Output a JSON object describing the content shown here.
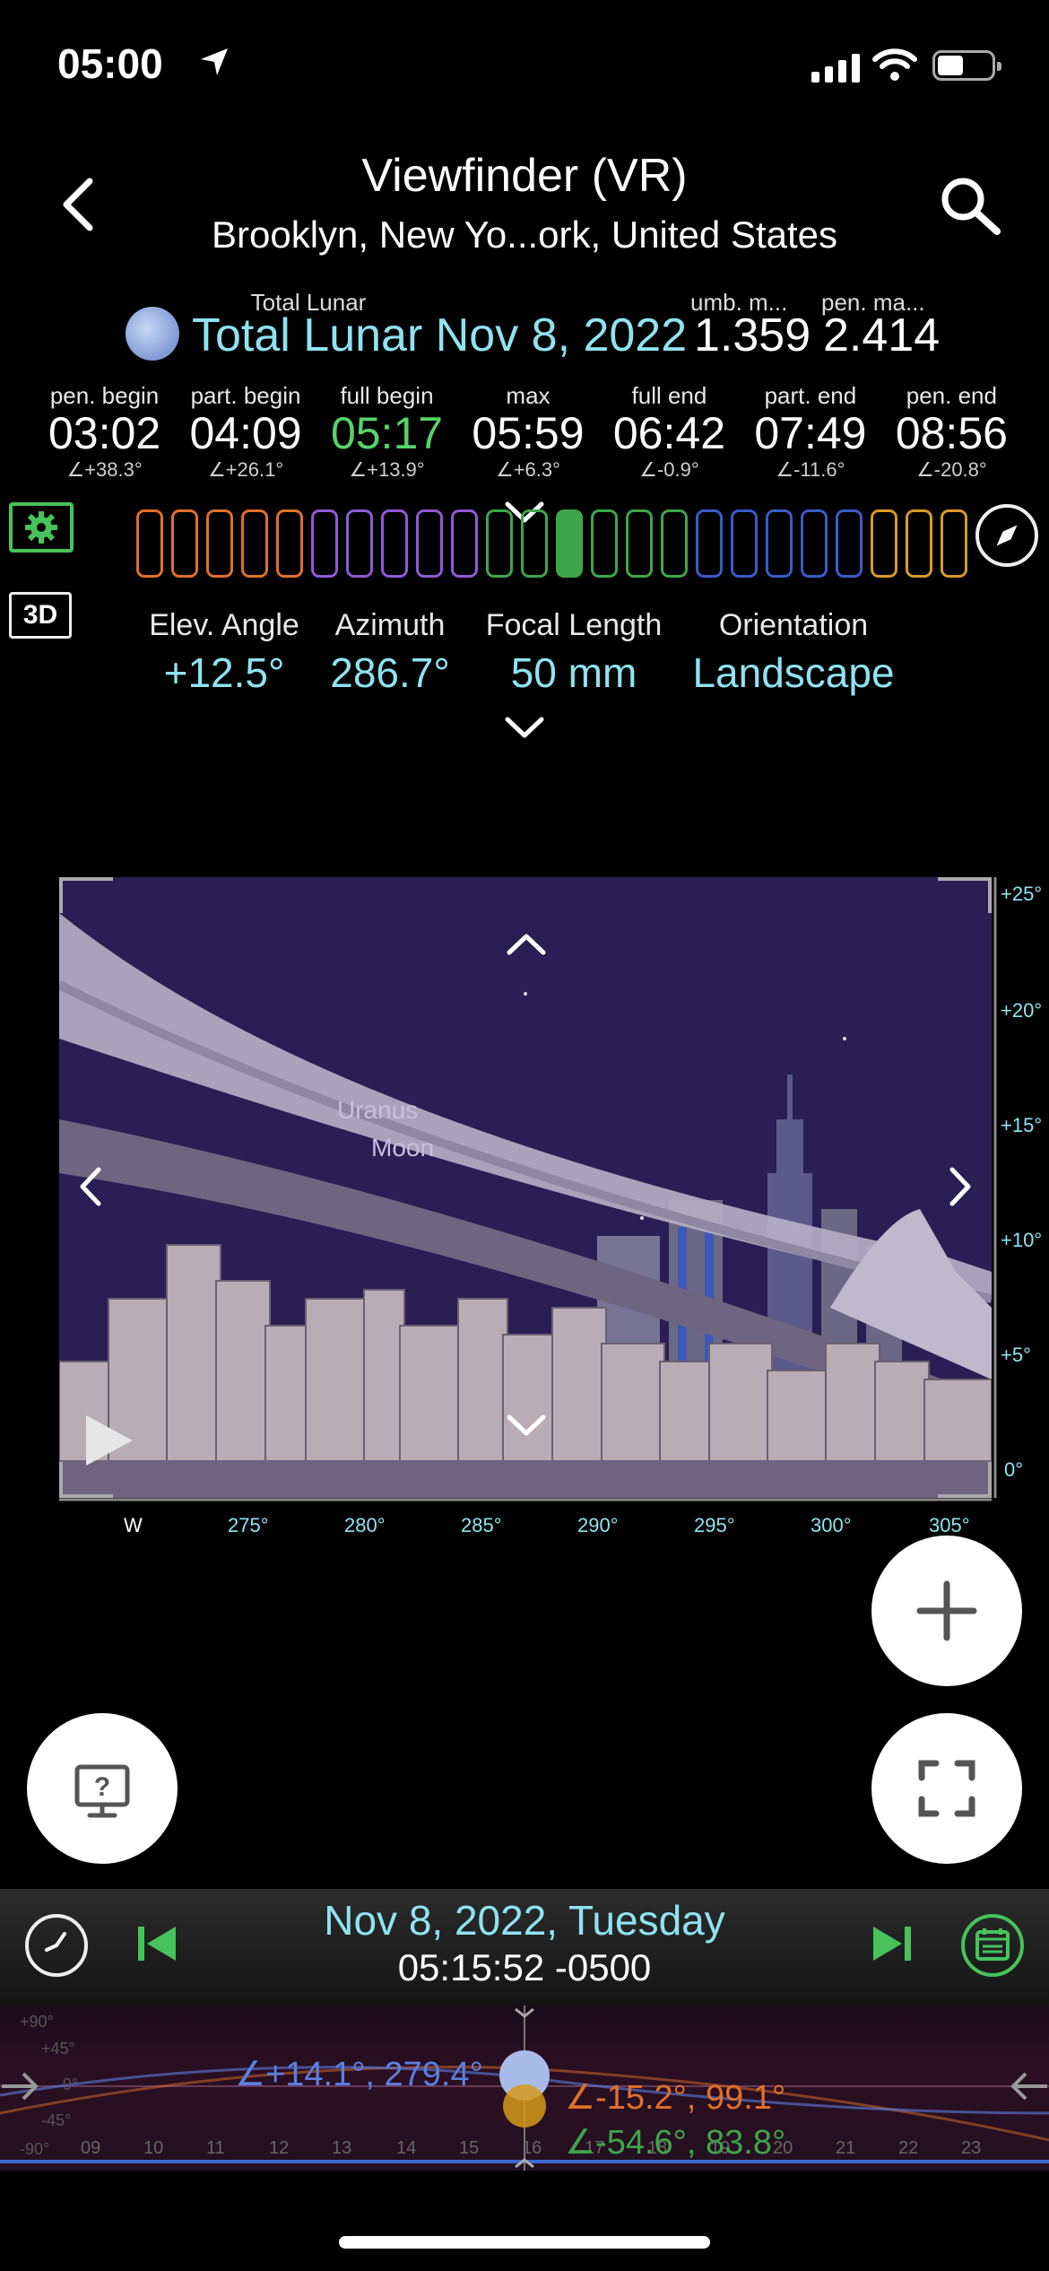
{
  "status": {
    "time": "05:00"
  },
  "header": {
    "title": "Viewfinder (VR)",
    "location": "Brooklyn, New Yo...ork, United States"
  },
  "eclipse": {
    "kind": "Total Lunar",
    "name": "Total Lunar Nov 8, 2022",
    "umb_label": "umb. m...",
    "umb_value": "1.359",
    "pen_label": "pen. ma...",
    "pen_value": "2.414"
  },
  "contacts": [
    {
      "label": "pen. begin",
      "time": "03:02",
      "alt": "∠+38.3°"
    },
    {
      "label": "part. begin",
      "time": "04:09",
      "alt": "∠+26.1°"
    },
    {
      "label": "full begin",
      "time": "05:17",
      "alt": "∠+13.9°"
    },
    {
      "label": "max",
      "time": "05:59",
      "alt": "∠+6.3°"
    },
    {
      "label": "full end",
      "time": "06:42",
      "alt": "∠-0.9°"
    },
    {
      "label": "part. end",
      "time": "07:49",
      "alt": "∠-11.6°"
    },
    {
      "label": "pen. end",
      "time": "08:56",
      "alt": "∠-20.8°"
    }
  ],
  "side": {
    "btn_3d": "3D"
  },
  "phase_bar_colors": [
    "#e0702a",
    "#e0702a",
    "#e0702a",
    "#e0702a",
    "#e0702a",
    "#8e5ad6",
    "#8e5ad6",
    "#8e5ad6",
    "#8e5ad6",
    "#8e5ad6",
    "#3da64a",
    "#3da64a",
    "#3da64a",
    "#3da64a",
    "#3da64a",
    "#3da64a",
    "#3a5bc8",
    "#3a5bc8",
    "#3a5bc8",
    "#3a5bc8",
    "#3a5bc8",
    "#d89a2a",
    "#d89a2a",
    "#d89a2a"
  ],
  "phase_bar_selected": 12,
  "params": {
    "elev_label": "Elev. Angle",
    "elev_value": "+12.5°",
    "az_label": "Azimuth",
    "az_value": "286.7°",
    "focal_label": "Focal Length",
    "focal_value": "50 mm",
    "orient_label": "Orientation",
    "orient_value": "Landscape"
  },
  "viewfinder": {
    "labels": [
      "Uranus",
      "Moon"
    ],
    "alt_ticks": [
      "+25°",
      "+20°",
      "+15°",
      "+10°",
      "+5°",
      "0°"
    ],
    "az_ticks": [
      "W",
      "275°",
      "280°",
      "285°",
      "290°",
      "295°",
      "300°",
      "305°"
    ]
  },
  "bottom": {
    "date": "Nov 8, 2022, Tuesday",
    "time": "05:15:52 -0500",
    "moon_pos": "∠+14.1°, 279.4°",
    "sun_pos": "∠-15.2°, 99.1°",
    "other_pos": "∠-54.6°, 83.8°",
    "deg_labels": [
      "+90°",
      "+45°",
      "0°",
      "-45°",
      "-90°"
    ],
    "hours": [
      "09",
      "10",
      "11",
      "12",
      "13",
      "14",
      "15",
      "16",
      "17",
      "18",
      "19",
      "20",
      "21",
      "22",
      "23"
    ]
  },
  "colors": {
    "accent_cyan": "#8fe3f0",
    "accent_green": "#57d26a",
    "moon_pos": "#5b7fe0",
    "sun_pos": "#e0702a",
    "other_pos": "#3da64a"
  }
}
